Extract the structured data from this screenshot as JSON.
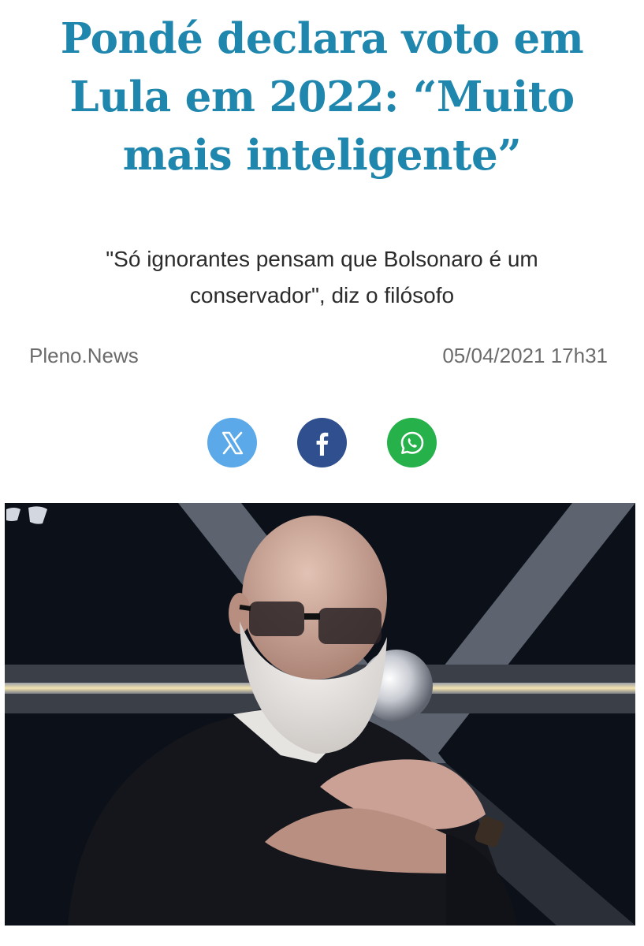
{
  "article": {
    "headline_lines": [
      "Pondé declara voto em",
      "Lula em 2022: “Muito",
      "mais inteligente”"
    ],
    "subtitle_lines": [
      "\"Só ignorantes pensam que Bolsonaro é um",
      "conservador\", diz o filósofo"
    ],
    "source": "Pleno.News",
    "datetime": "05/04/2021 17h31"
  },
  "share": {
    "buttons": [
      {
        "network": "x",
        "icon": "x-logo-icon",
        "color": "#5ba9e8"
      },
      {
        "network": "facebook",
        "icon": "facebook-f-icon",
        "color": "#2f4f8f"
      },
      {
        "network": "whatsapp",
        "icon": "whatsapp-icon",
        "color": "#27b14b"
      }
    ]
  },
  "colors": {
    "headline": "#1f86ad",
    "subtitle": "#2b2b2b",
    "meta": "#6b6b6b"
  }
}
